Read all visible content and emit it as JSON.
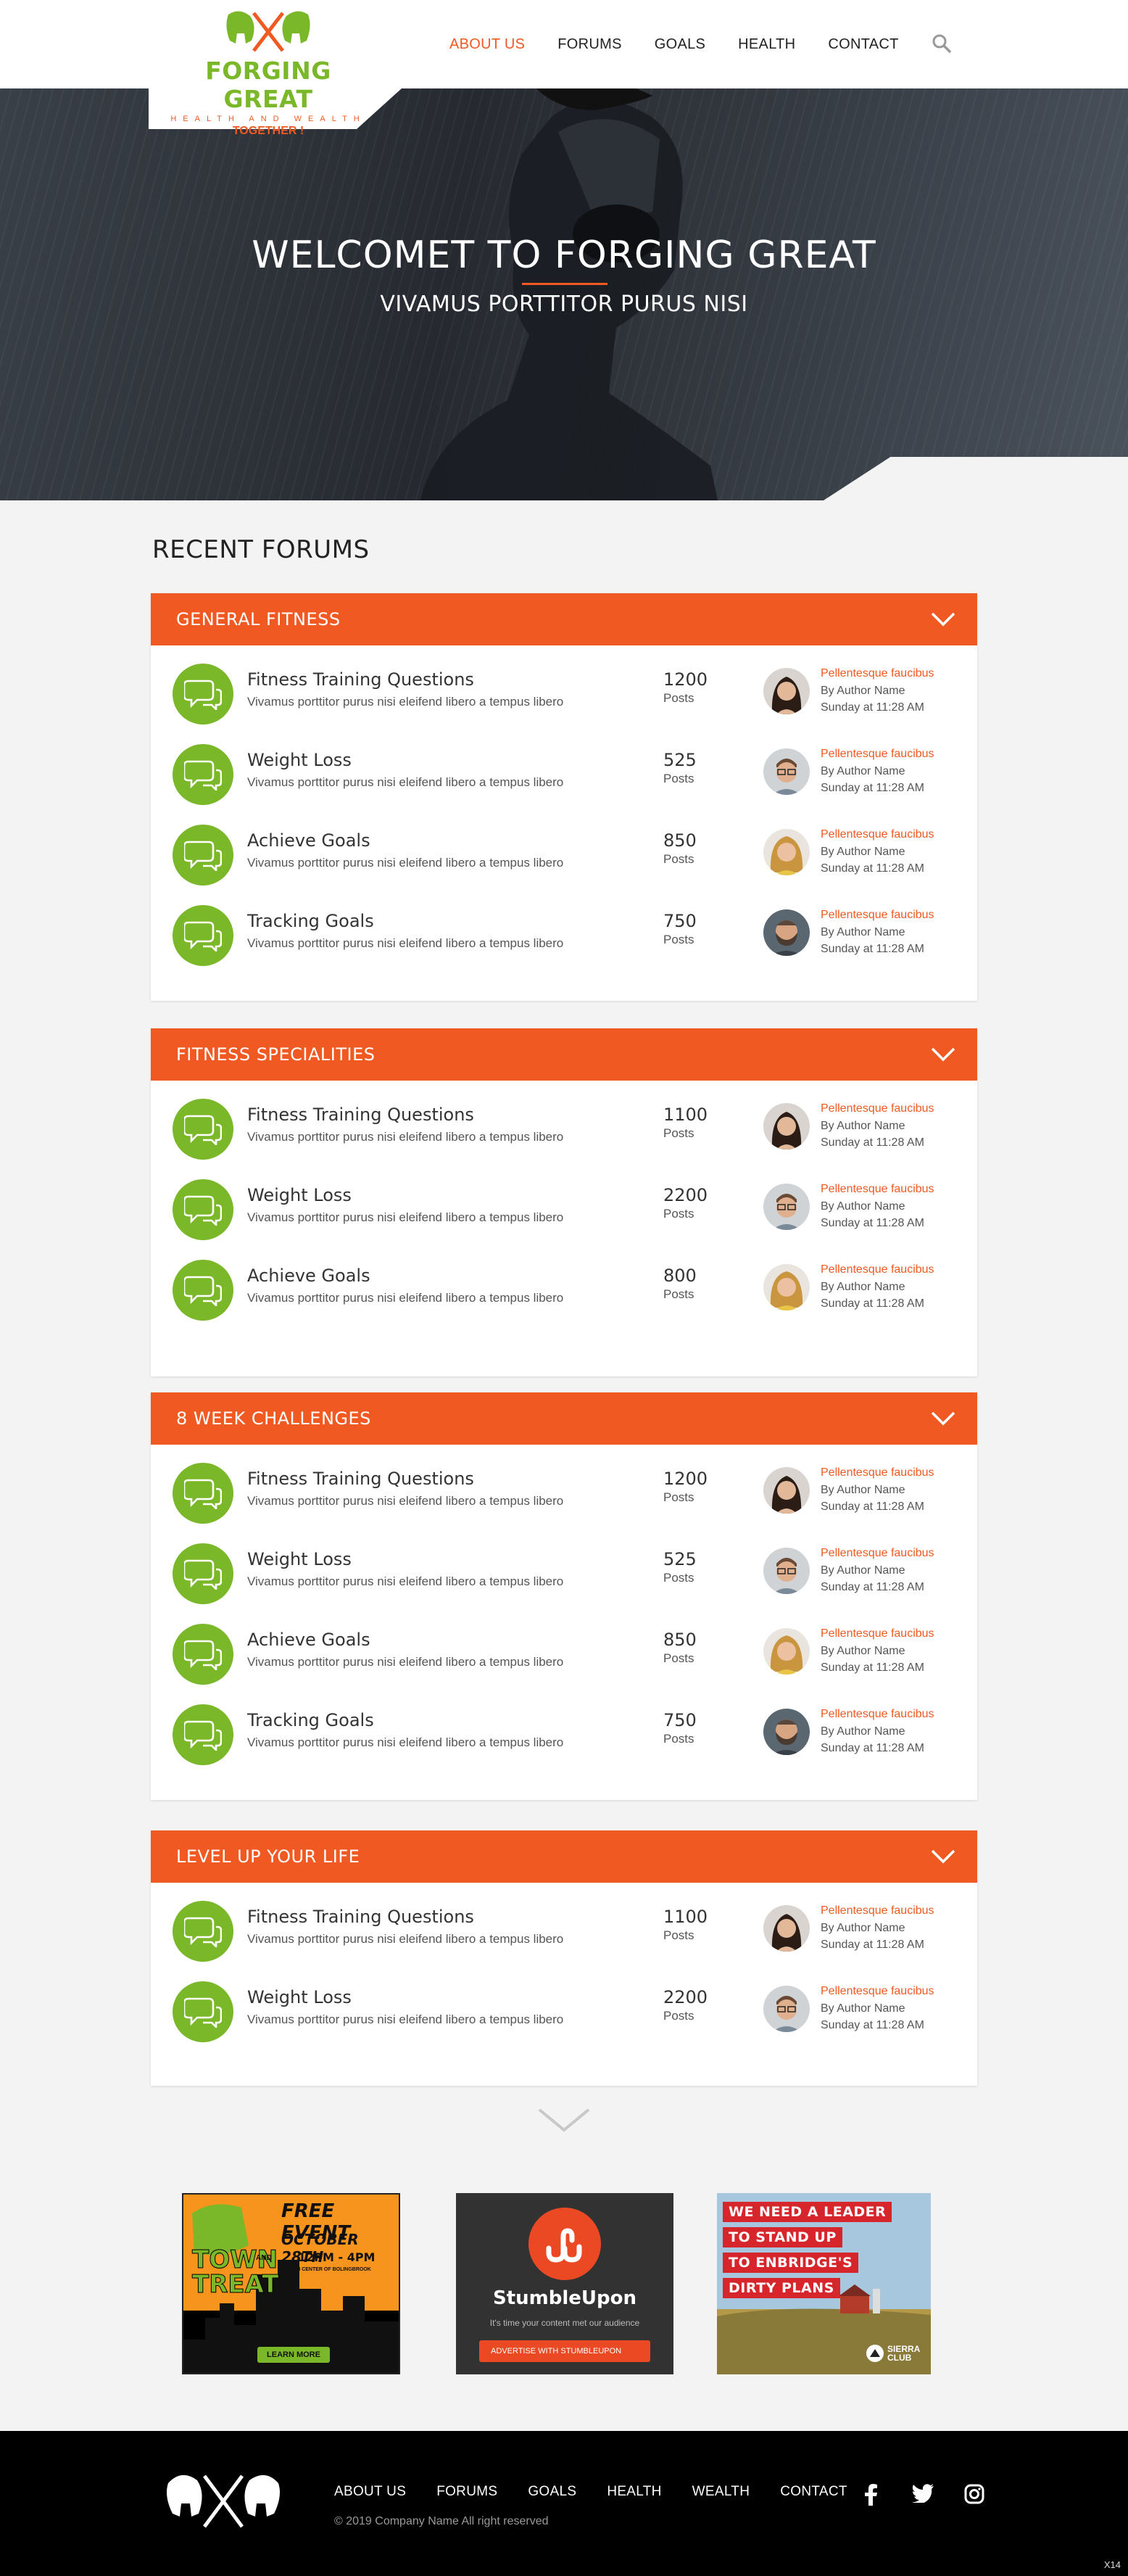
{
  "header": {
    "logo_brand": "FORGING GREAT",
    "logo_tagline": "HEALTH AND WEALTH",
    "logo_together": "TOGETHER !",
    "nav": [
      "ABOUT US",
      "FORUMS",
      "GOALS",
      "HEALTH",
      "CONTACT"
    ],
    "active_nav": "ABOUT US"
  },
  "hero": {
    "title": "WELCOMET TO FORGING GREAT",
    "subtitle": "VIVAMUS PORTTITOR PURUS NISI"
  },
  "recent_title": "RECENT FORUMS",
  "sections": [
    {
      "title": "GENERAL FITNESS",
      "rows": [
        {
          "title": "Fitness Training Questions",
          "desc": "Vivamus porttitor purus nisi eleifend libero a tempus libero",
          "count": "1200",
          "count_label": "Posts",
          "link": "Pellentesque faucibus",
          "by": "By Author Name",
          "when": "Sunday at 11:28 AM",
          "avatar": "woman-dark-hair"
        },
        {
          "title": "Weight Loss",
          "desc": "Vivamus porttitor purus nisi eleifend libero a tempus libero",
          "count": "525",
          "count_label": "Posts",
          "link": "Pellentesque faucibus",
          "by": "By Author Name",
          "when": "Sunday at 11:28 AM",
          "avatar": "man-glasses"
        },
        {
          "title": "Achieve Goals",
          "desc": "Vivamus porttitor purus nisi eleifend libero a tempus libero",
          "count": "850",
          "count_label": "Posts",
          "link": "Pellentesque faucibus",
          "by": "By Author Name",
          "when": "Sunday at 11:28 AM",
          "avatar": "woman-blonde"
        },
        {
          "title": "Tracking Goals",
          "desc": "Vivamus porttitor purus nisi eleifend libero a tempus libero",
          "count": "750",
          "count_label": "Posts",
          "link": "Pellentesque faucibus",
          "by": "By Author Name",
          "when": "Sunday at 11:28 AM",
          "avatar": "man-beard"
        }
      ]
    },
    {
      "title": "FITNESS SPECIALITIES",
      "rows": [
        {
          "title": "Fitness Training Questions",
          "desc": "Vivamus porttitor purus nisi eleifend libero a tempus libero",
          "count": "1100",
          "count_label": "Posts",
          "link": "Pellentesque faucibus",
          "by": "By Author Name",
          "when": "Sunday at 11:28 AM",
          "avatar": "woman-dark-hair"
        },
        {
          "title": "Weight Loss",
          "desc": "Vivamus porttitor purus nisi eleifend libero a tempus libero",
          "count": "2200",
          "count_label": "Posts",
          "link": "Pellentesque faucibus",
          "by": "By Author Name",
          "when": "Sunday at 11:28 AM",
          "avatar": "man-glasses"
        },
        {
          "title": "Achieve Goals",
          "desc": "Vivamus porttitor purus nisi eleifend libero a tempus libero",
          "count": "800",
          "count_label": "Posts",
          "link": "Pellentesque faucibus",
          "by": "By Author Name",
          "when": "Sunday at 11:28 AM",
          "avatar": "woman-blonde"
        }
      ]
    },
    {
      "title": "8 WEEK CHALLENGES",
      "rows": [
        {
          "title": "Fitness Training Questions",
          "desc": "Vivamus porttitor purus nisi eleifend libero a tempus libero",
          "count": "1200",
          "count_label": "Posts",
          "link": "Pellentesque faucibus",
          "by": "By Author Name",
          "when": "Sunday at 11:28 AM",
          "avatar": "woman-dark-hair"
        },
        {
          "title": "Weight Loss",
          "desc": "Vivamus porttitor purus nisi eleifend libero a tempus libero",
          "count": "525",
          "count_label": "Posts",
          "link": "Pellentesque faucibus",
          "by": "By Author Name",
          "when": "Sunday at 11:28 AM",
          "avatar": "man-glasses"
        },
        {
          "title": "Achieve Goals",
          "desc": "Vivamus porttitor purus nisi eleifend libero a tempus libero",
          "count": "850",
          "count_label": "Posts",
          "link": "Pellentesque faucibus",
          "by": "By Author Name",
          "when": "Sunday at 11:28 AM",
          "avatar": "woman-blonde"
        },
        {
          "title": "Tracking Goals",
          "desc": "Vivamus porttitor purus nisi eleifend libero a tempus libero",
          "count": "750",
          "count_label": "Posts",
          "link": "Pellentesque faucibus",
          "by": "By Author Name",
          "when": "Sunday at 11:28 AM",
          "avatar": "man-beard"
        }
      ]
    },
    {
      "title": "LEVEL UP YOUR LIFE",
      "rows": [
        {
          "title": "Fitness Training Questions",
          "desc": "Vivamus porttitor purus nisi eleifend libero a tempus libero",
          "count": "1100",
          "count_label": "Posts",
          "link": "Pellentesque faucibus",
          "by": "By Author Name",
          "when": "Sunday at 11:28 AM",
          "avatar": "woman-dark-hair"
        },
        {
          "title": "Weight Loss",
          "desc": "Vivamus porttitor purus nisi eleifend libero a tempus libero",
          "count": "2200",
          "count_label": "Posts",
          "link": "Pellentesque faucibus",
          "by": "By Author Name",
          "when": "Sunday at 11:28 AM",
          "avatar": "man-glasses"
        }
      ]
    }
  ],
  "ads": {
    "ad1": {
      "event": "FREE EVENT",
      "brand_line1": "TOWN",
      "brand_mid": "AND",
      "brand_line2": "TREAT",
      "date": "OCTOBER 28TH",
      "time": "12PM - 4PM",
      "place": "TOWN CENTER OF BOLINGBROOK",
      "cta": "LEARN MORE"
    },
    "ad2": {
      "brand": "StumbleUpon",
      "tagline": "It's time your content met our audience",
      "cta": "ADVERTISE WITH STUMBLEUPON"
    },
    "ad3": {
      "lines": [
        "WE NEED A LEADER",
        "TO STAND UP",
        "TO ENBRIDGE'S",
        "DIRTY PLANS"
      ],
      "org_line1": "SIERRA",
      "org_line2": "CLUB"
    }
  },
  "footer": {
    "nav": [
      "ABOUT US",
      "FORUMS",
      "GOALS",
      "HEALTH",
      "WEALTH",
      "CONTACT"
    ],
    "copyright": "© 2019 Company Name  All right reserved",
    "corner": "X14",
    "social": [
      "facebook-icon",
      "twitter-icon",
      "instagram-icon"
    ]
  },
  "colors": {
    "accent": "#f05a22",
    "green": "#7ab829",
    "footer": "#000000"
  }
}
